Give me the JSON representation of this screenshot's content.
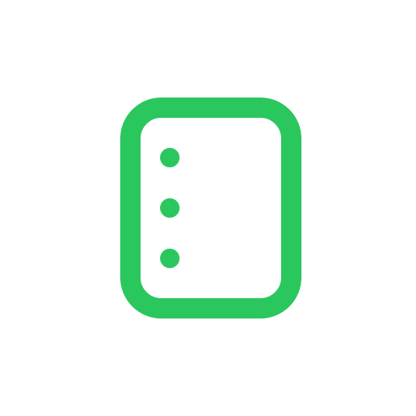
{
  "icon": {
    "name": "list-document-icon",
    "stroke_color": "#2AC75F",
    "background_color": "#FFFFFF",
    "bullet_count": 3
  }
}
